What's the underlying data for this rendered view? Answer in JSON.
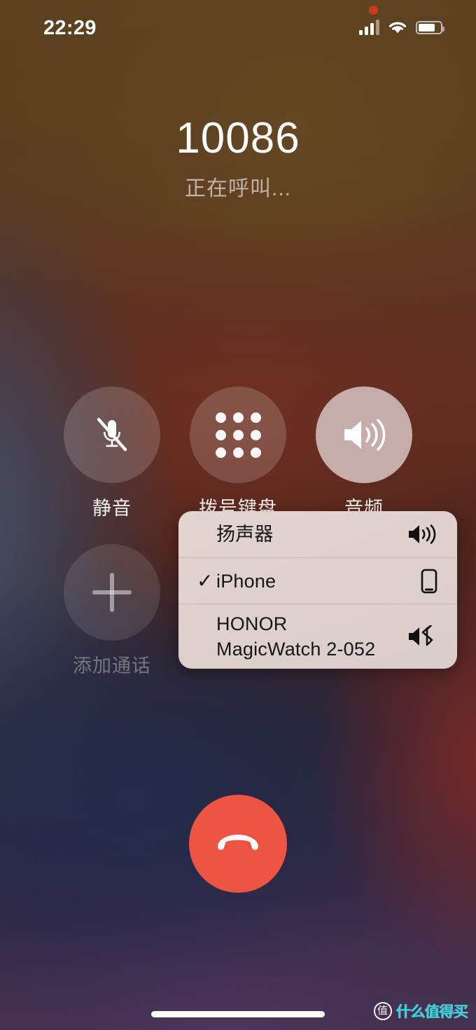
{
  "status_bar": {
    "time": "22:29",
    "recording_dot": "recording-indicator",
    "cellular_icon": "cellular-signal-icon",
    "cellular_bars_filled": 3,
    "cellular_bars_total": 4,
    "wifi_icon": "wifi-icon",
    "battery_icon": "battery-icon",
    "battery_level_percent": 68
  },
  "call": {
    "number": "10086",
    "status_text": "正在呼叫..."
  },
  "actions": [
    {
      "label": "静音",
      "icon": "microphone-muted-icon",
      "state": "normal"
    },
    {
      "label": "拨号键盘",
      "icon": "keypad-icon",
      "state": "normal"
    },
    {
      "label": "音频",
      "icon": "speaker-waves-icon",
      "state": "active"
    },
    {
      "label": "添加通话",
      "icon": "plus-icon",
      "state": "disabled"
    }
  ],
  "audio_popup": {
    "routes": [
      {
        "label": "扬声器",
        "icon": "speaker-waves-icon",
        "selected": false,
        "check": ""
      },
      {
        "label": "iPhone",
        "icon": "iphone-device-icon",
        "selected": true,
        "check": "✓"
      },
      {
        "label": "HONOR MagicWatch 2-052",
        "icon": "bluetooth-speaker-icon",
        "selected": false,
        "check": ""
      }
    ]
  },
  "end_call": {
    "icon": "hang-up-icon",
    "color": "#EE5442"
  },
  "home_indicator": "home-indicator",
  "watermark": {
    "badge_text": "值",
    "text": "什么值得买",
    "color": "#2DE0E8"
  }
}
